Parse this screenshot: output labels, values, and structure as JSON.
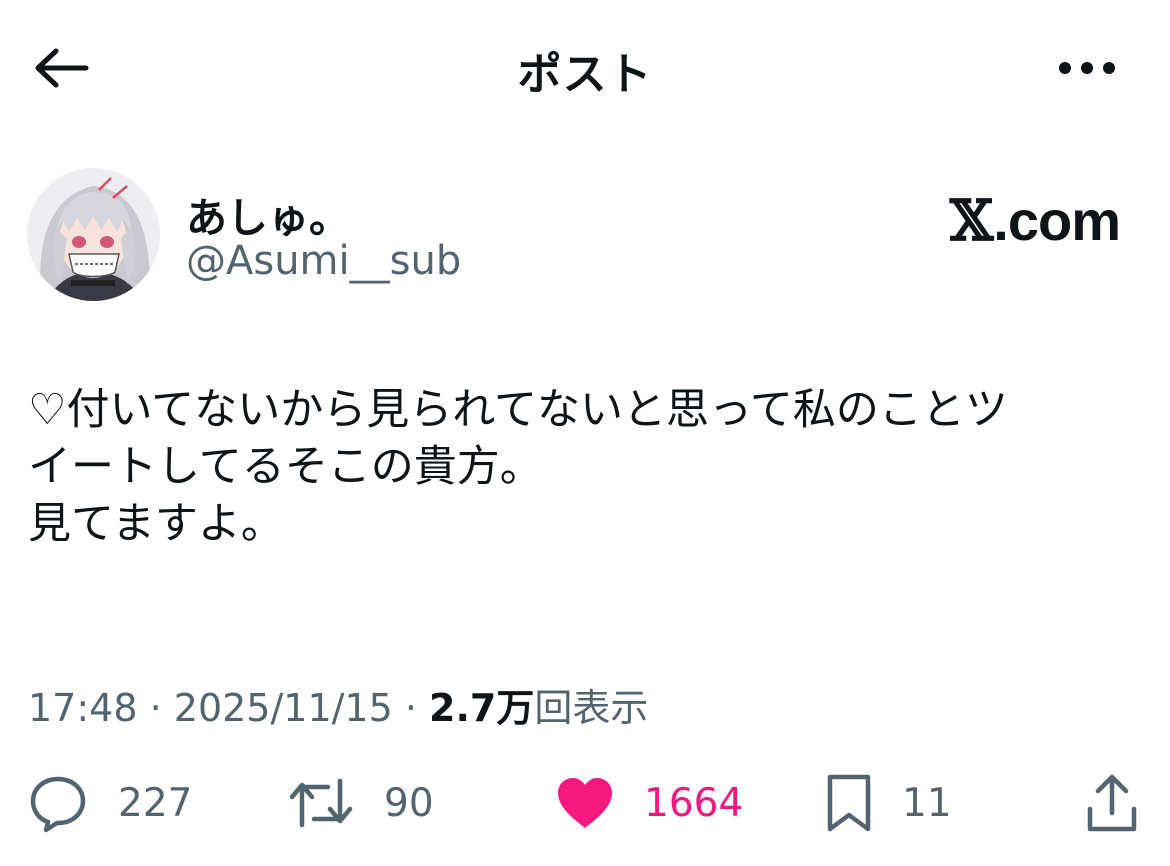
{
  "header": {
    "title": "ポスト",
    "back_icon": "arrow-left-icon",
    "more_icon": "more-horizontal-icon"
  },
  "author": {
    "name": "あしゅ。",
    "handle": "@Asumi__sub",
    "avatar": "avatar-illustration"
  },
  "brand": {
    "mark": "𝕏",
    "suffix": ".com"
  },
  "post": {
    "lines": [
      "♡付いてないから見られてないと思って私のことツ",
      "イートしてるそこの貴方。",
      "見てますよ。"
    ]
  },
  "meta": {
    "time": "17:48",
    "sep1": " · ",
    "date": "2025/11/15",
    "sep2": " · ",
    "views_count": "2.7万",
    "views_label": "回表示"
  },
  "actions": {
    "reply_count": "227",
    "repost_count": "90",
    "like_count": "1664",
    "bookmark_count": "11"
  },
  "colors": {
    "text": "#0f1419",
    "secondary": "#536471",
    "like": "#f91880"
  }
}
